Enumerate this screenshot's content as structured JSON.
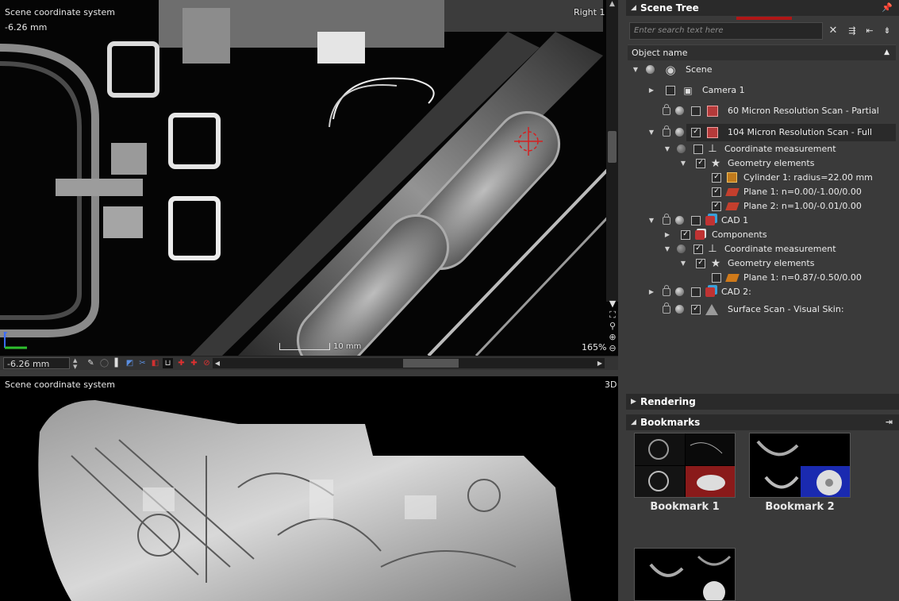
{
  "top_view": {
    "label": "Scene coordinate system",
    "name": "Right 1",
    "position_readout": "-6.26 mm",
    "scale_label": "10 mm",
    "zoom_level": "165%",
    "position_field": "-6.26 mm"
  },
  "bottom_view": {
    "label": "Scene coordinate system",
    "name": "3D"
  },
  "scene_tree": {
    "title": "Scene Tree",
    "search_placeholder": "Enter search text here",
    "column_header": "Object name",
    "items": [
      {
        "label": "Scene",
        "icon": "globe-icon"
      },
      {
        "label": "Camera 1",
        "icon": "camera-icon"
      },
      {
        "label": "60 Micron Resolution Scan - Partial",
        "icon": "volume-icon"
      },
      {
        "label": "104 Micron Resolution Scan - Full",
        "icon": "volume-icon",
        "selected": true
      },
      {
        "label": "Coordinate measurement",
        "icon": "coordinate-axes-icon"
      },
      {
        "label": "Geometry elements",
        "icon": "star-icon"
      },
      {
        "label": "Cylinder 1: radius=22.00 mm",
        "icon": "cylinder-icon"
      },
      {
        "label": "Plane 1: n=0.00/-1.00/0.00",
        "icon": "plane-icon"
      },
      {
        "label": "Plane 2: n=1.00/-0.01/0.00",
        "icon": "plane-icon"
      },
      {
        "label": "CAD 1",
        "icon": "cad-icon"
      },
      {
        "label": "Components",
        "icon": "cad-components-icon"
      },
      {
        "label": "Coordinate measurement",
        "icon": "coordinate-axes-icon"
      },
      {
        "label": "Geometry elements",
        "icon": "star-icon"
      },
      {
        "label": "Plane 1: n=0.87/-0.50/0.00",
        "icon": "plane-icon"
      },
      {
        "label": "CAD 2:",
        "icon": "cad-icon"
      },
      {
        "label": "Surface Scan - Visual Skin:",
        "icon": "surface-skin-icon"
      }
    ]
  },
  "rendering": {
    "title": "Rendering"
  },
  "bookmarks": {
    "title": "Bookmarks",
    "items": [
      {
        "label": "Bookmark 1"
      },
      {
        "label": "Bookmark 2"
      },
      {
        "label": ""
      }
    ]
  },
  "colors": {
    "panel_bg": "#3a3a3a",
    "header_bg": "#2a2a2a",
    "accent_red": "#b01616"
  }
}
